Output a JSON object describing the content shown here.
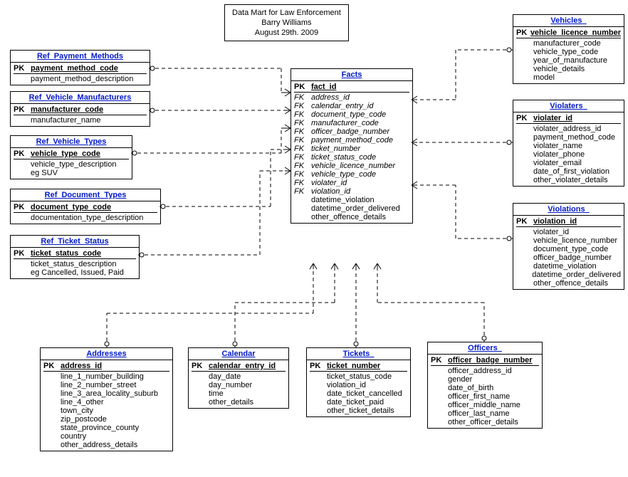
{
  "title": {
    "l1": "Data Mart for Law Enforcement",
    "l2": "Barry Williams",
    "l3": "August 29th. 2009"
  },
  "facts": {
    "name": "Facts",
    "pk": "fact_id",
    "fks": [
      "address_id",
      "calendar_entry_id",
      "document_type_code",
      "manufacturer_code",
      "officer_badge_number",
      "payment_method_code",
      "ticket_number",
      "ticket_status_code",
      "vehicle_licence_number",
      "vehicle_type_code",
      "violater_id",
      "violation_id"
    ],
    "attrs": [
      "datetime_violation",
      "datetime_order_delivered",
      "other_offence_details"
    ]
  },
  "ref_payment": {
    "name": "Ref_Payment_Methods",
    "pk": "payment_method_code",
    "attrs": [
      "payment_method_description"
    ]
  },
  "ref_mfr": {
    "name": "Ref_Vehicle_Manufacturers",
    "pk": "manufacturer_code",
    "attrs": [
      "manufacturer_name"
    ]
  },
  "ref_vtype": {
    "name": "Ref_Vehicle_Types",
    "pk": "vehicle_type_code",
    "attrs": [
      "vehicle_type_description",
      "eg SUV"
    ]
  },
  "ref_doc": {
    "name": "Ref_Document_Types",
    "pk": "document_type_code",
    "attrs": [
      "documentation_type_description"
    ]
  },
  "ref_ticket": {
    "name": "Ref_Ticket_Status",
    "pk": "ticket_status_code",
    "attrs": [
      "ticket_status_description",
      "eg Cancelled, Issued, Paid"
    ]
  },
  "vehicles": {
    "name": "Vehicles_",
    "pk": "vehicle_licence_number",
    "attrs": [
      "manufacturer_code",
      "vehicle_type_code",
      "year_of_manufacture",
      "vehicle_details",
      "model"
    ]
  },
  "violaters": {
    "name": "Violaters_",
    "pk": "violater_id",
    "attrs": [
      "violater_address_id",
      "payment_method_code",
      "violater_name",
      "violater_phone",
      "violater_email",
      "date_of_first_violation",
      "other_violater_details"
    ]
  },
  "violations": {
    "name": "Violations_",
    "pk": "violation_id",
    "attrs": [
      "violater_id",
      "vehicle_licence_number",
      "document_type_code",
      "officer_badge_number",
      "datetime_violation",
      "datetime_order_delivered",
      "other_offence_details"
    ]
  },
  "addresses": {
    "name": "Addresses",
    "pk": "address_id",
    "attrs": [
      "line_1_number_building",
      "line_2_number_street",
      "line_3_area_locality_suburb",
      "line_4_other",
      "town_city",
      "zip_postcode",
      "state_province_county",
      "country",
      "other_address_details"
    ]
  },
  "calendar": {
    "name": "Calendar",
    "pk": "calendar_entry_id",
    "attrs": [
      "day_date",
      "day_number",
      "time",
      "other_details"
    ]
  },
  "tickets": {
    "name": "Tickets_",
    "pk": "ticket_number",
    "attrs": [
      "ticket_status_code",
      "violation_id",
      "date_ticket_cancelled",
      "date_ticket_paid",
      "other_ticket_details"
    ]
  },
  "officers": {
    "name": "Officers_",
    "pk": "officer_badge_number",
    "attrs": [
      "officer_address_id",
      "gender",
      "date_of_birth",
      "officer_first_name",
      "officer_middle_name",
      "officer_last_name",
      "other_officer_details"
    ]
  }
}
